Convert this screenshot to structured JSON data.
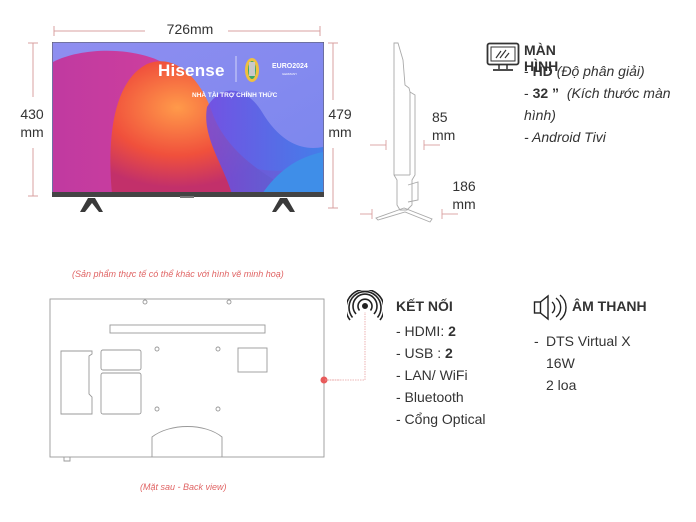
{
  "dimensions": {
    "width": "726mm",
    "height_without_stand": [
      "430",
      "mm"
    ],
    "height_with_stand": [
      "479",
      "mm"
    ],
    "depth_without_stand": [
      "85",
      "mm"
    ],
    "depth_with_stand": [
      "186",
      "mm"
    ]
  },
  "tv_screen": {
    "brand": "Hisense",
    "event": "EURO2024",
    "event_sub": "GERMANY",
    "sponsor_text": "NHÀ TÀI TRỢ CHÍNH THỨC"
  },
  "disclaimer": "(Sản phẩm thực tế có thể khác với hình vẽ minh hoạ)",
  "back_view_label": "(Mặt sau - Back view)",
  "screen_spec": {
    "icon": "monitor-icon",
    "title": "MÀN HÌNH",
    "resolution_value": "HD",
    "resolution_label": "(Độ phân giải)",
    "size_value": "32 ”",
    "size_label": "(Kích thước màn",
    "size_label_cont": "hình)",
    "os": "- Android Tivi",
    "dash": "- "
  },
  "connectivity_spec": {
    "icon": "wireless-signal-icon",
    "title": "KẾT NỐI",
    "hdmi_label": "- HDMI: ",
    "hdmi_value": "2",
    "usb_label": "- USB : ",
    "usb_value": "2",
    "network": "- LAN/ WiFi",
    "bluetooth": "- Bluetooth",
    "optical": "- Cổng Optical"
  },
  "audio_spec": {
    "icon": "speaker-icon",
    "title": "ÂM THANH",
    "dash": "-",
    "technology": "DTS Virtual X",
    "power": "16W",
    "speakers": "2 loa"
  },
  "colors": {
    "dimension_line": "#d9a0a0",
    "accent_red": "#e85a5a",
    "outline_gray": "#999999",
    "text": "#333333"
  }
}
